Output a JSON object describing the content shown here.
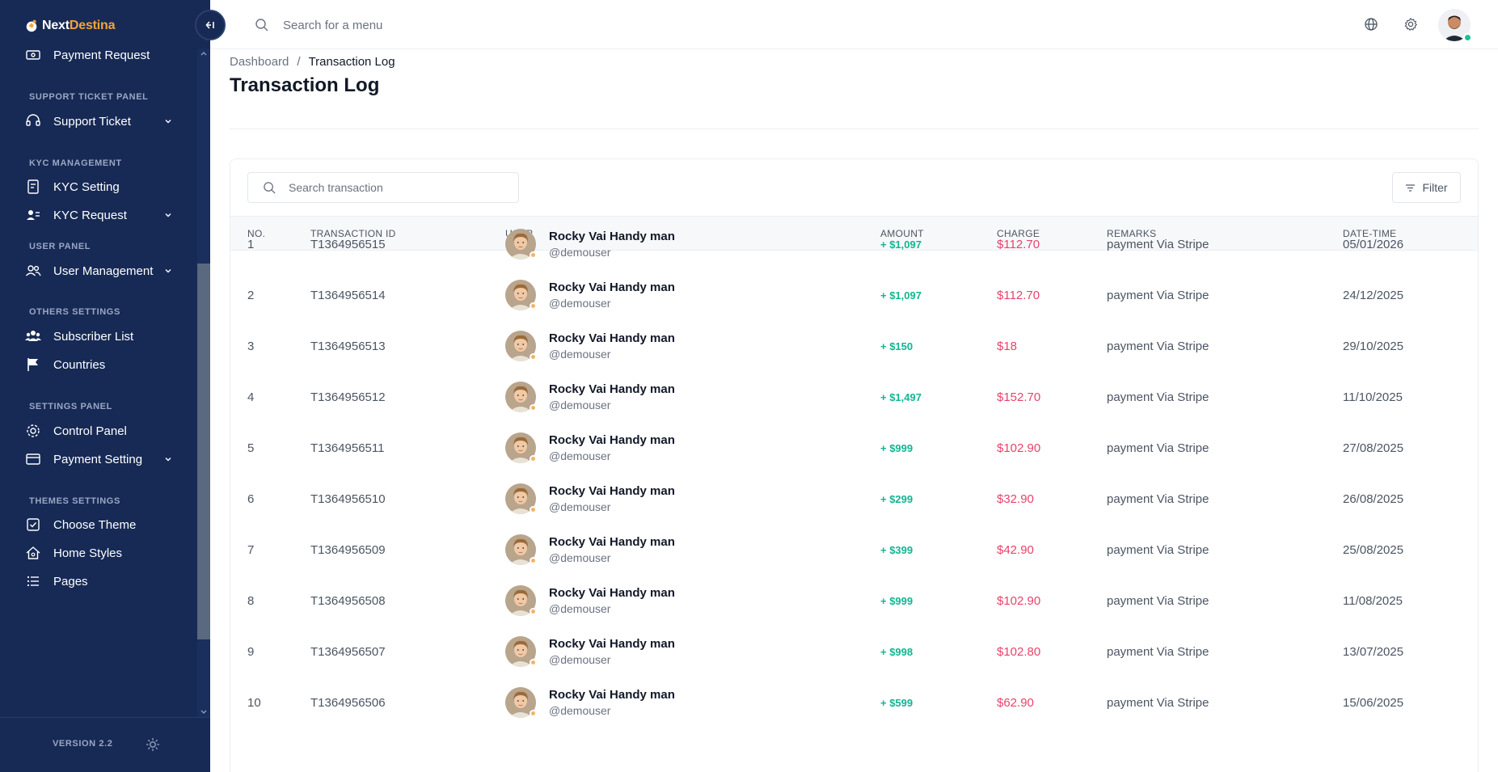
{
  "brand": {
    "name_part1": "Next",
    "name_part2": "Destina"
  },
  "colors": {
    "sidebar_bg": "#172a55",
    "amount_positive": "#12b592",
    "charge": "#e8436b",
    "status_online": "#19c39a",
    "status_away": "#f3b36a",
    "brand_accent": "#f6a33a"
  },
  "sidebar": {
    "items": [
      {
        "kind": "item",
        "label": "Payment Request",
        "icon": "money-icon",
        "chevron": false
      },
      {
        "kind": "section",
        "label": "SUPPORT TICKET PANEL"
      },
      {
        "kind": "item",
        "label": "Support Ticket",
        "icon": "headset-icon",
        "chevron": true
      },
      {
        "kind": "section",
        "label": "KYC MANAGEMENT"
      },
      {
        "kind": "item",
        "label": "KYC Setting",
        "icon": "document-icon",
        "chevron": false
      },
      {
        "kind": "item",
        "label": "KYC Request",
        "icon": "user-card-icon",
        "chevron": true
      },
      {
        "kind": "section",
        "label": "USER PANEL"
      },
      {
        "kind": "item",
        "label": "User Management",
        "icon": "users-icon",
        "chevron": true
      },
      {
        "kind": "section",
        "label": "OTHERS SETTINGS"
      },
      {
        "kind": "item",
        "label": "Subscriber List",
        "icon": "group-icon",
        "chevron": false
      },
      {
        "kind": "item",
        "label": "Countries",
        "icon": "flag-icon",
        "chevron": false
      },
      {
        "kind": "section",
        "label": "SETTINGS PANEL"
      },
      {
        "kind": "item",
        "label": "Control Panel",
        "icon": "gear-icon",
        "chevron": false
      },
      {
        "kind": "item",
        "label": "Payment Setting",
        "icon": "card-icon",
        "chevron": true
      },
      {
        "kind": "section",
        "label": "THEMES SETTINGS"
      },
      {
        "kind": "item",
        "label": "Choose Theme",
        "icon": "checkbox-icon",
        "chevron": false
      },
      {
        "kind": "item",
        "label": "Home Styles",
        "icon": "home-icon",
        "chevron": false
      },
      {
        "kind": "item",
        "label": "Pages",
        "icon": "list-icon",
        "chevron": false
      }
    ],
    "version": "VERSION 2.2"
  },
  "topbar": {
    "search_placeholder": "Search for a menu"
  },
  "breadcrumb": {
    "home": "Dashboard",
    "separator": "/",
    "current": "Transaction Log"
  },
  "page_title": "Transaction Log",
  "table": {
    "search_placeholder": "Search transaction",
    "filter_label": "Filter",
    "columns": [
      "NO.",
      "TRANSACTION ID",
      "USER",
      "AMOUNT",
      "CHARGE",
      "REMARKS",
      "DATE-TIME"
    ],
    "rows": [
      {
        "no": "1",
        "tid": "T1364956515",
        "name": "Rocky Vai Handy man",
        "handle": "@demouser",
        "amount": "+ $1,097",
        "charge": "$112.70",
        "remarks": "payment Via Stripe",
        "date": "05/01/2026"
      },
      {
        "no": "2",
        "tid": "T1364956514",
        "name": "Rocky Vai Handy man",
        "handle": "@demouser",
        "amount": "+ $1,097",
        "charge": "$112.70",
        "remarks": "payment Via Stripe",
        "date": "24/12/2025"
      },
      {
        "no": "3",
        "tid": "T1364956513",
        "name": "Rocky Vai Handy man",
        "handle": "@demouser",
        "amount": "+ $150",
        "charge": "$18",
        "remarks": "payment Via Stripe",
        "date": "29/10/2025"
      },
      {
        "no": "4",
        "tid": "T1364956512",
        "name": "Rocky Vai Handy man",
        "handle": "@demouser",
        "amount": "+ $1,497",
        "charge": "$152.70",
        "remarks": "payment Via Stripe",
        "date": "11/10/2025"
      },
      {
        "no": "5",
        "tid": "T1364956511",
        "name": "Rocky Vai Handy man",
        "handle": "@demouser",
        "amount": "+ $999",
        "charge": "$102.90",
        "remarks": "payment Via Stripe",
        "date": "27/08/2025"
      },
      {
        "no": "6",
        "tid": "T1364956510",
        "name": "Rocky Vai Handy man",
        "handle": "@demouser",
        "amount": "+ $299",
        "charge": "$32.90",
        "remarks": "payment Via Stripe",
        "date": "26/08/2025"
      },
      {
        "no": "7",
        "tid": "T1364956509",
        "name": "Rocky Vai Handy man",
        "handle": "@demouser",
        "amount": "+ $399",
        "charge": "$42.90",
        "remarks": "payment Via Stripe",
        "date": "25/08/2025"
      },
      {
        "no": "8",
        "tid": "T1364956508",
        "name": "Rocky Vai Handy man",
        "handle": "@demouser",
        "amount": "+ $999",
        "charge": "$102.90",
        "remarks": "payment Via Stripe",
        "date": "11/08/2025"
      },
      {
        "no": "9",
        "tid": "T1364956507",
        "name": "Rocky Vai Handy man",
        "handle": "@demouser",
        "amount": "+ $998",
        "charge": "$102.80",
        "remarks": "payment Via Stripe",
        "date": "13/07/2025"
      },
      {
        "no": "10",
        "tid": "T1364956506",
        "name": "Rocky Vai Handy man",
        "handle": "@demouser",
        "amount": "+ $599",
        "charge": "$62.90",
        "remarks": "payment Via Stripe",
        "date": "15/06/2025"
      }
    ]
  }
}
